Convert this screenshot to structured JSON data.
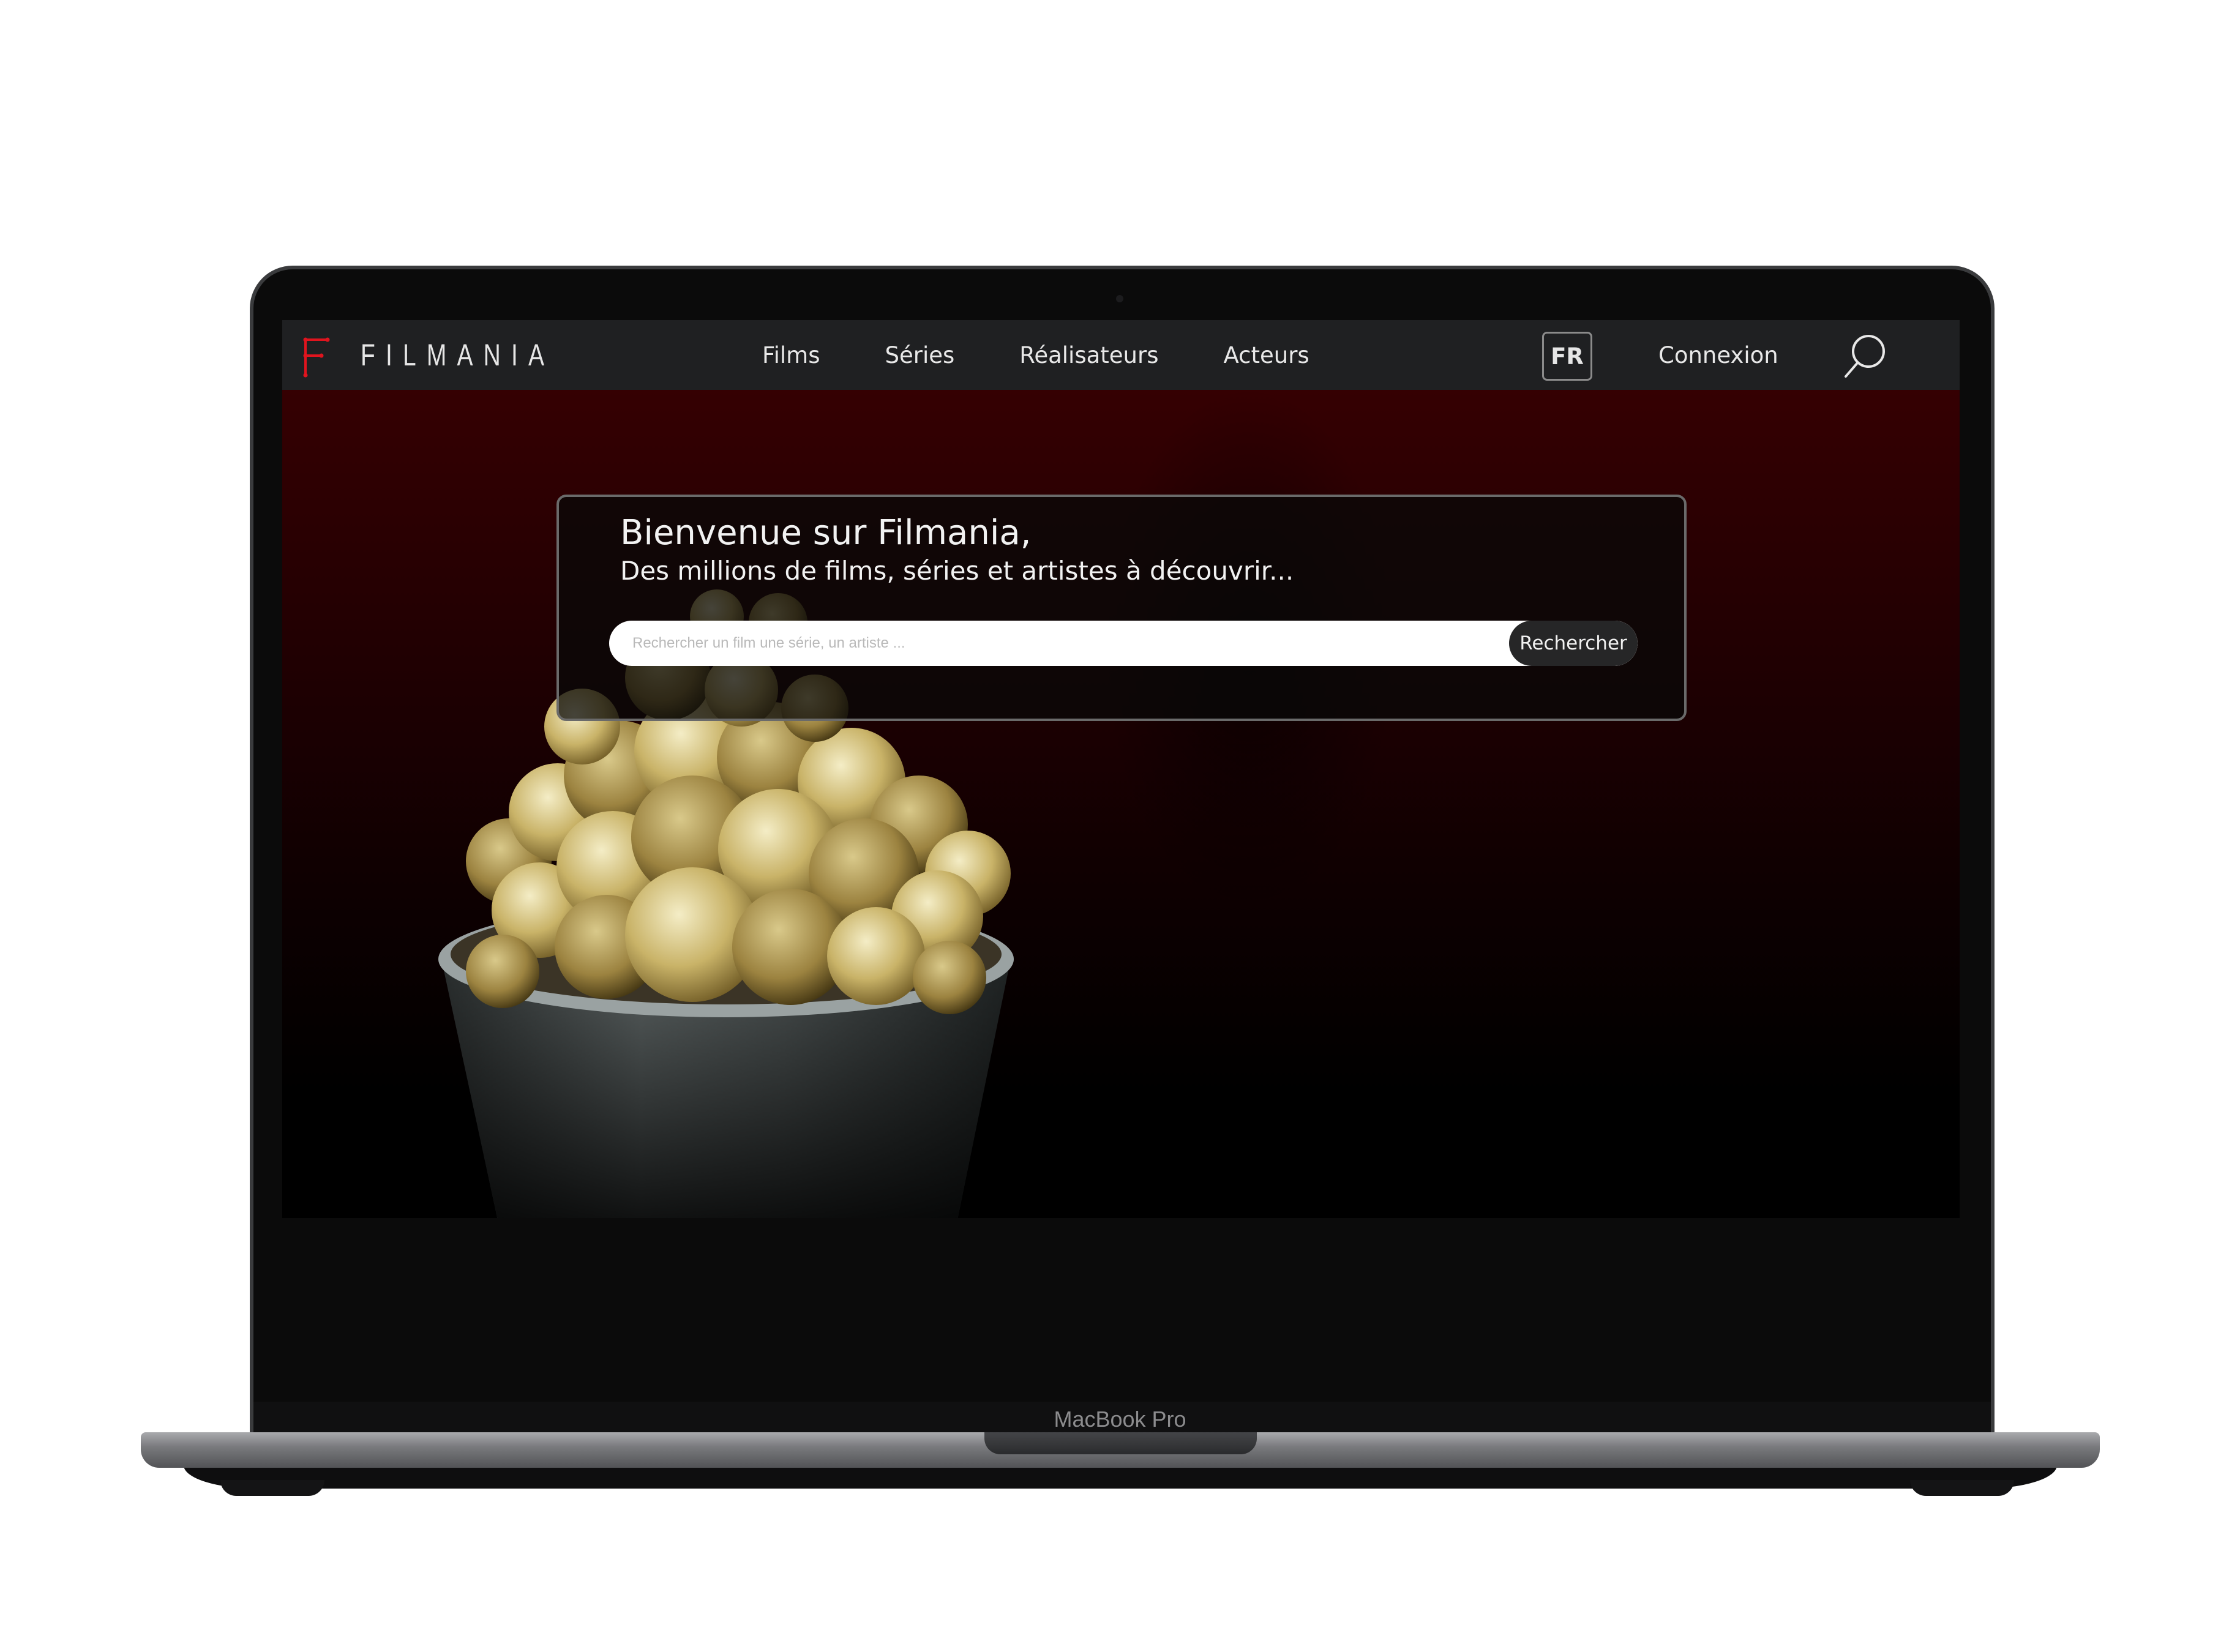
{
  "device": {
    "model_label": "MacBook Pro"
  },
  "brand": {
    "name": "FILMANIA",
    "logo_icon": "film-reel-f-icon",
    "accent": "#e0141e"
  },
  "nav": {
    "links": [
      {
        "label": "Films"
      },
      {
        "label": "Séries"
      },
      {
        "label": "Réalisateurs"
      },
      {
        "label": "Acteurs"
      }
    ],
    "language": "FR",
    "login_label": "Connexion",
    "search_icon": "search-icon"
  },
  "hero": {
    "image": "popcorn-bucket",
    "title": "Bienvenue sur Filmania,",
    "subtitle": "Des millions de films, séries et artistes à découvrir...",
    "search": {
      "placeholder": "Rechercher un film une série, un artiste ...",
      "value": "",
      "button_label": "Rechercher"
    }
  },
  "colors": {
    "nav_bg": "#1f2022",
    "hero_top": "#350002",
    "hero_bottom": "#000000",
    "panel_border": "#6a6a6a"
  }
}
